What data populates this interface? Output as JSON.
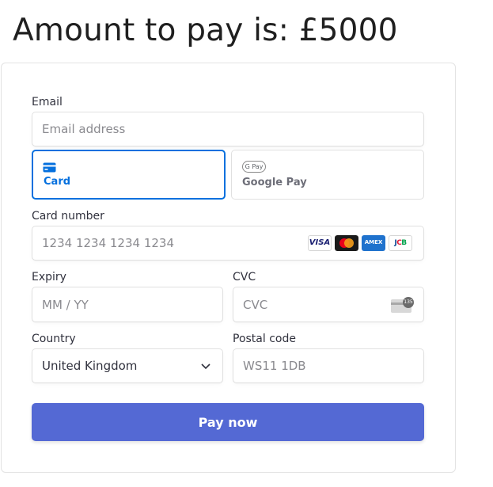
{
  "heading": "Amount to pay is: £5000",
  "email": {
    "label": "Email",
    "placeholder": "Email address"
  },
  "payment_tabs": [
    {
      "label": "Card",
      "icon": "card-icon",
      "active": true
    },
    {
      "label": "Google Pay",
      "icon": "google-pay-icon",
      "badge": "G Pay",
      "active": false
    }
  ],
  "card_number": {
    "label": "Card number",
    "placeholder": "1234 1234 1234 1234",
    "brands": [
      "VISA",
      "mastercard",
      "AMEX",
      "JCB"
    ]
  },
  "expiry": {
    "label": "Expiry",
    "placeholder": "MM / YY"
  },
  "cvc": {
    "label": "CVC",
    "placeholder": "CVC",
    "icon_badge": "135"
  },
  "country": {
    "label": "Country",
    "value": "United Kingdom"
  },
  "postal": {
    "label": "Postal code",
    "placeholder": "WS11 1DB"
  },
  "pay_button": {
    "label": "Pay now"
  },
  "colors": {
    "accent": "#0570de",
    "button": "#5469d4",
    "visa": "#1a1f71",
    "amex": "#1f72cd"
  }
}
